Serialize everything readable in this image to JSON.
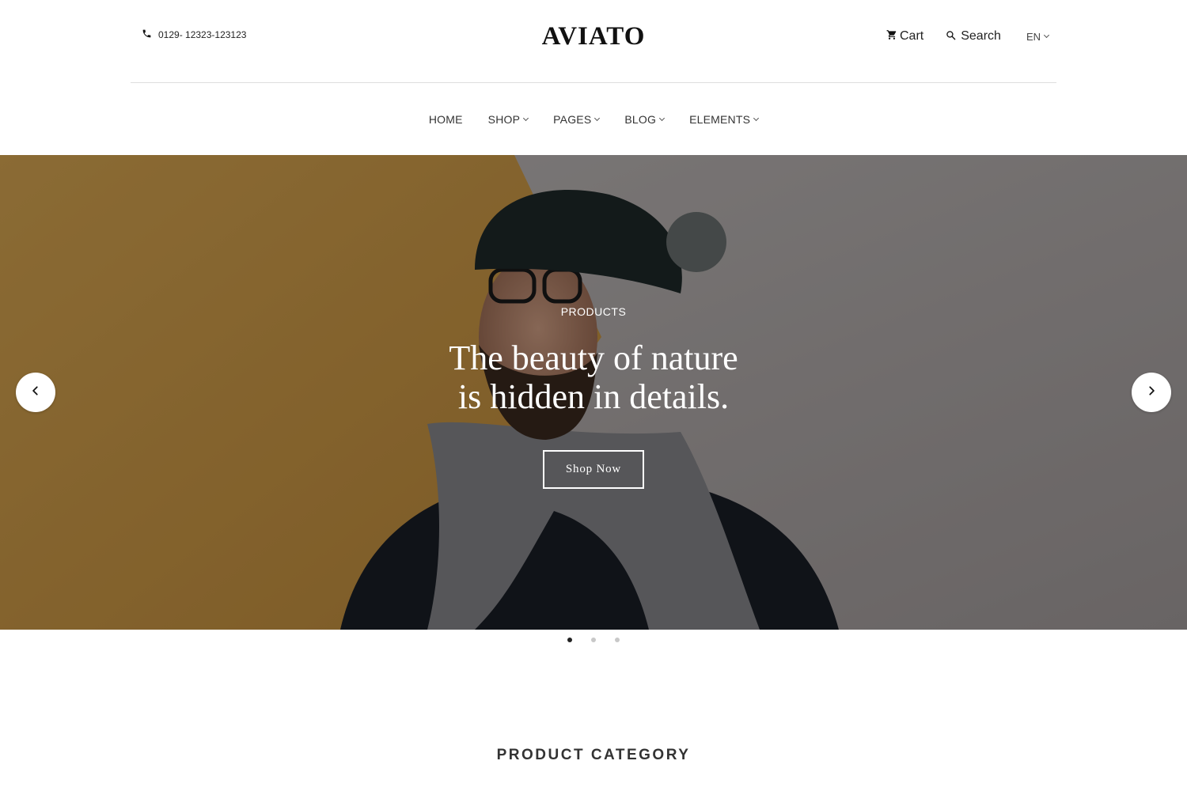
{
  "topbar": {
    "phone_number": "0129- 12323-123123",
    "logo_text": "AVIATO",
    "cart_label": "Cart",
    "search_label": "Search",
    "language": "EN"
  },
  "nav": {
    "items": [
      {
        "label": "HOME",
        "has_dropdown": false
      },
      {
        "label": "SHOP",
        "has_dropdown": true
      },
      {
        "label": "PAGES",
        "has_dropdown": true
      },
      {
        "label": "BLOG",
        "has_dropdown": true
      },
      {
        "label": "ELEMENTS",
        "has_dropdown": true
      }
    ]
  },
  "hero": {
    "kicker": "PRODUCTS",
    "title_line1": "The beauty of nature",
    "title_line2": "is hidden in details.",
    "cta_label": "Shop Now",
    "active_slide": 1,
    "slide_count": 3
  },
  "sections": {
    "category_heading": "PRODUCT CATEGORY"
  },
  "icons": {
    "phone": "phone-icon",
    "cart": "cart-icon",
    "search": "search-icon",
    "prev": "chevron-left-icon",
    "next": "chevron-right-icon"
  },
  "colors": {
    "text": "#222222",
    "divider": "#dedede",
    "dot_active": "#222222",
    "dot_inactive": "#c8c8c8",
    "overlay": "rgba(0,0,0,0.38)"
  }
}
